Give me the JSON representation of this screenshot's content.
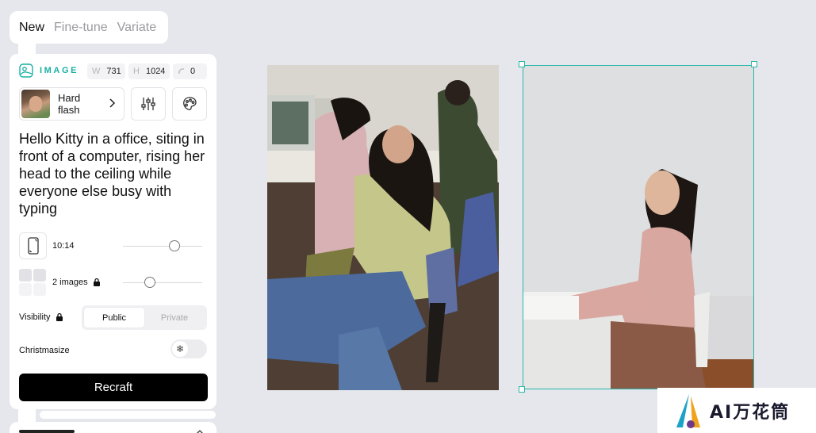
{
  "tabs": [
    {
      "label": "New"
    },
    {
      "label": "Fine-tune"
    },
    {
      "label": "Variate"
    }
  ],
  "header": {
    "section_label": "IMAGE",
    "width_key": "W",
    "width_value": "731",
    "height_key": "H",
    "height_value": "1024",
    "seed_value": "0"
  },
  "style": {
    "name": "Hard flash"
  },
  "prompt": "Hello Kitty in a office, siting in front of a computer, rising her head to the ceiling while everyone else busy with typing",
  "aspect": {
    "label": "10:14"
  },
  "images": {
    "label": "2 images",
    "count": 2
  },
  "visibility": {
    "label": "Visibility",
    "options": [
      "Public",
      "Private"
    ],
    "selected": "Public"
  },
  "christmasize": {
    "label": "Christmasize",
    "enabled": false
  },
  "actions": {
    "recraft_label": "Recraft"
  },
  "watermark": {
    "logo_text": "AI万花筒"
  },
  "colors": {
    "accent": "#1ab0a4",
    "primary_button": "#000000",
    "background": "#e6e7ec"
  }
}
